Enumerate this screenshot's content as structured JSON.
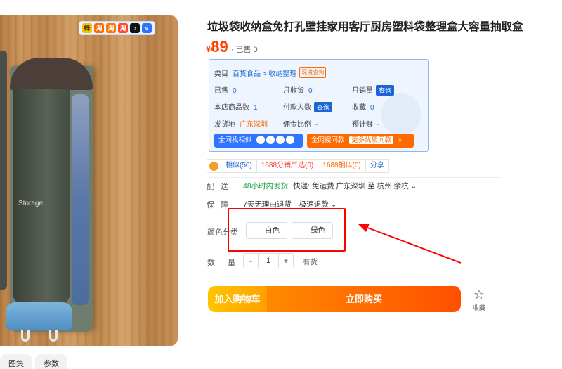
{
  "product": {
    "title": "垃圾袋收纳盒免打孔壁挂家用客厅厨房塑料袋整理盒大容量抽取盒",
    "currency": "¥",
    "price": "89",
    "sold_text": "· 已售 0",
    "image_storage_text": "Storage"
  },
  "source_badges": [
    "蜂",
    "淘",
    "淘",
    "淘",
    "♪",
    "v"
  ],
  "plugin": {
    "category_label": "类目",
    "category_value": "百货食品 > 收纳整理",
    "deep_query": "深度查询",
    "sold_label": "已售",
    "sold_value": "0",
    "monthly_collect_label": "月收货",
    "monthly_collect_value": "0",
    "monthly_sales_label": "月销量",
    "monthly_sales_btn": "查询",
    "store_count_label": "本店商品数",
    "store_count_value": "1",
    "payers_label": "付款人数",
    "payers_btn": "查询",
    "favorites_label": "收藏",
    "favorites_value": "0",
    "ship_from_label": "发货地",
    "ship_from_value": "广东深圳",
    "commission_label": "佣金比例",
    "commission_value": "-",
    "est_earning_label": "预计赚",
    "est_earning_value": "-",
    "find_similar_btn": "全网找相似",
    "search_same_btn": "全网搜同款",
    "more_sources_btn": "更多优质同款"
  },
  "tags": {
    "similar": "相似(50)",
    "strict": "1688分销严选(0)",
    "similar1688": "1688相似(0)",
    "share": "分享"
  },
  "shipping": {
    "label": "配送",
    "speed": "48小时内发货",
    "detail": "快递: 免运费  广东深圳  至  杭州 余杭 ⌄"
  },
  "guarantee": {
    "label": "保障",
    "item1": "7天无理由退货",
    "item2": "极速退款 ⌄"
  },
  "color": {
    "label": "颜色分类",
    "options": [
      "白色",
      "绿色"
    ]
  },
  "quantity": {
    "label": "数量",
    "minus": "-",
    "value": "1",
    "plus": "+",
    "stock": "有货"
  },
  "actions": {
    "add_to_cart": "加入购物车",
    "buy_now": "立即购买",
    "favorite": "收藏",
    "favorite_icon": "☆"
  },
  "thumb_tabs": [
    "图集",
    "参数"
  ],
  "colors": {
    "accent": "#ff4000",
    "plugin_blue": "#2f74ff",
    "annotation_red": "#ff0000"
  }
}
